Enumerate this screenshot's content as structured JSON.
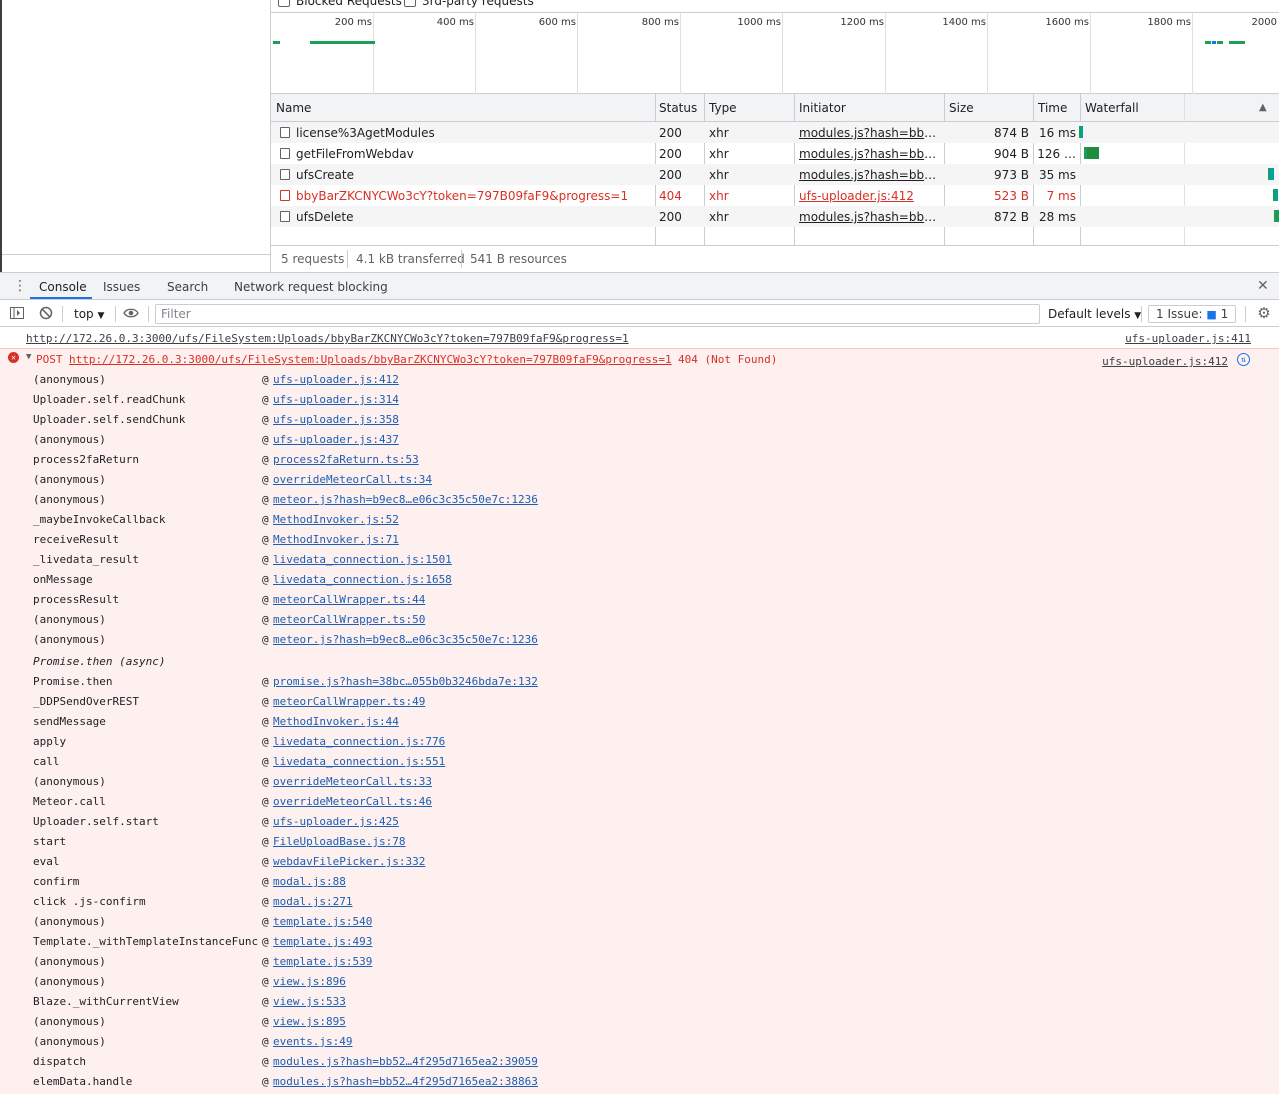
{
  "network": {
    "filters": {
      "blocked_requests": "Blocked Requests",
      "third_party": "3rd-party requests"
    },
    "timeline_ticks": [
      "200 ms",
      "400 ms",
      "600 ms",
      "800 ms",
      "1000 ms",
      "1200 ms",
      "1400 ms",
      "1600 ms",
      "1800 ms",
      "2000"
    ],
    "columns": {
      "name": "Name",
      "status": "Status",
      "type": "Type",
      "initiator": "Initiator",
      "size": "Size",
      "time": "Time",
      "waterfall": "Waterfall"
    },
    "rows": [
      {
        "name": "license%3AgetModules",
        "status": "200",
        "type": "xhr",
        "initiator": "modules.js?hash=bb52f…",
        "size": "874 B",
        "time": "16 ms",
        "error": false
      },
      {
        "name": "getFileFromWebdav",
        "status": "200",
        "type": "xhr",
        "initiator": "modules.js?hash=bb52f…",
        "size": "904 B",
        "time": "126 …",
        "error": false
      },
      {
        "name": "ufsCreate",
        "status": "200",
        "type": "xhr",
        "initiator": "modules.js?hash=bb52f…",
        "size": "973 B",
        "time": "35 ms",
        "error": false
      },
      {
        "name": "bbyBarZKCNYCWo3cY?token=797B09faF9&progress=1",
        "status": "404",
        "type": "xhr",
        "initiator": "ufs-uploader.js:412",
        "size": "523 B",
        "time": "7 ms",
        "error": true
      },
      {
        "name": "ufsDelete",
        "status": "200",
        "type": "xhr",
        "initiator": "modules.js?hash=bb52f…",
        "size": "872 B",
        "time": "28 ms",
        "error": false
      }
    ],
    "summary": {
      "requests": "5 requests",
      "transferred": "4.1 kB transferred",
      "resources": "541 B resources"
    }
  },
  "drawer": {
    "tabs": [
      "Console",
      "Issues",
      "Search",
      "Network request blocking"
    ],
    "context": "top",
    "filter_placeholder": "Filter",
    "levels": "Default levels",
    "issues_label": "1 Issue:",
    "issues_count": "1"
  },
  "console": {
    "log_url": "http://172.26.0.3:3000/ufs/FileSystem:Uploads/bbyBarZKCNYCWo3cY?token=797B09faF9&progress=1",
    "log_src": "ufs-uploader.js:411",
    "error_method": "POST",
    "error_url": "http://172.26.0.3:3000/ufs/FileSystem:Uploads/bbyBarZKCNYCWo3cY?token=797B09faF9&progress=1",
    "error_status": "404 (Not Found)",
    "error_src": "ufs-uploader.js:412",
    "at_symbol": "@",
    "async_label": "Promise.then (async)",
    "frames_a": [
      {
        "fn": "(anonymous)",
        "src": "ufs-uploader.js:412"
      },
      {
        "fn": "Uploader.self.readChunk",
        "src": "ufs-uploader.js:314"
      },
      {
        "fn": "Uploader.self.sendChunk",
        "src": "ufs-uploader.js:358"
      },
      {
        "fn": "(anonymous)",
        "src": "ufs-uploader.js:437"
      },
      {
        "fn": "process2faReturn",
        "src": "process2faReturn.ts:53"
      },
      {
        "fn": "(anonymous)",
        "src": "overrideMeteorCall.ts:34"
      },
      {
        "fn": "(anonymous)",
        "src": "meteor.js?hash=b9ec8…e06c3c35c50e7c:1236"
      },
      {
        "fn": "_maybeInvokeCallback",
        "src": "MethodInvoker.js:52"
      },
      {
        "fn": "receiveResult",
        "src": "MethodInvoker.js:71"
      },
      {
        "fn": "_livedata_result",
        "src": "livedata_connection.js:1501"
      },
      {
        "fn": "onMessage",
        "src": "livedata_connection.js:1658"
      },
      {
        "fn": "processResult",
        "src": "meteorCallWrapper.ts:44"
      },
      {
        "fn": "(anonymous)",
        "src": "meteorCallWrapper.ts:50"
      },
      {
        "fn": "(anonymous)",
        "src": "meteor.js?hash=b9ec8…e06c3c35c50e7c:1236"
      }
    ],
    "frames_b": [
      {
        "fn": "Promise.then",
        "src": "promise.js?hash=38bc…055b0b3246bda7e:132"
      },
      {
        "fn": "_DDPSendOverREST",
        "src": "meteorCallWrapper.ts:49"
      },
      {
        "fn": "sendMessage",
        "src": "MethodInvoker.js:44"
      },
      {
        "fn": "apply",
        "src": "livedata_connection.js:776"
      },
      {
        "fn": "call",
        "src": "livedata_connection.js:551"
      },
      {
        "fn": "(anonymous)",
        "src": "overrideMeteorCall.ts:33"
      },
      {
        "fn": "Meteor.call",
        "src": "overrideMeteorCall.ts:46"
      },
      {
        "fn": "Uploader.self.start",
        "src": "ufs-uploader.js:425"
      },
      {
        "fn": "start",
        "src": "FileUploadBase.js:78"
      },
      {
        "fn": "eval",
        "src": "webdavFilePicker.js:332"
      },
      {
        "fn": "confirm",
        "src": "modal.js:88"
      },
      {
        "fn": "click .js-confirm",
        "src": "modal.js:271"
      },
      {
        "fn": "(anonymous)",
        "src": "template.js:540"
      },
      {
        "fn": "Template._withTemplateInstanceFunc",
        "src": "template.js:493"
      },
      {
        "fn": "(anonymous)",
        "src": "template.js:539"
      },
      {
        "fn": "(anonymous)",
        "src": "view.js:896"
      },
      {
        "fn": "Blaze._withCurrentView",
        "src": "view.js:533"
      },
      {
        "fn": "(anonymous)",
        "src": "view.js:895"
      },
      {
        "fn": "(anonymous)",
        "src": "events.js:49"
      },
      {
        "fn": "dispatch",
        "src": "modules.js?hash=bb52…4f295d7165ea2:39059"
      },
      {
        "fn": "elemData.handle",
        "src": "modules.js?hash=bb52…4f295d7165ea2:38863"
      }
    ]
  }
}
